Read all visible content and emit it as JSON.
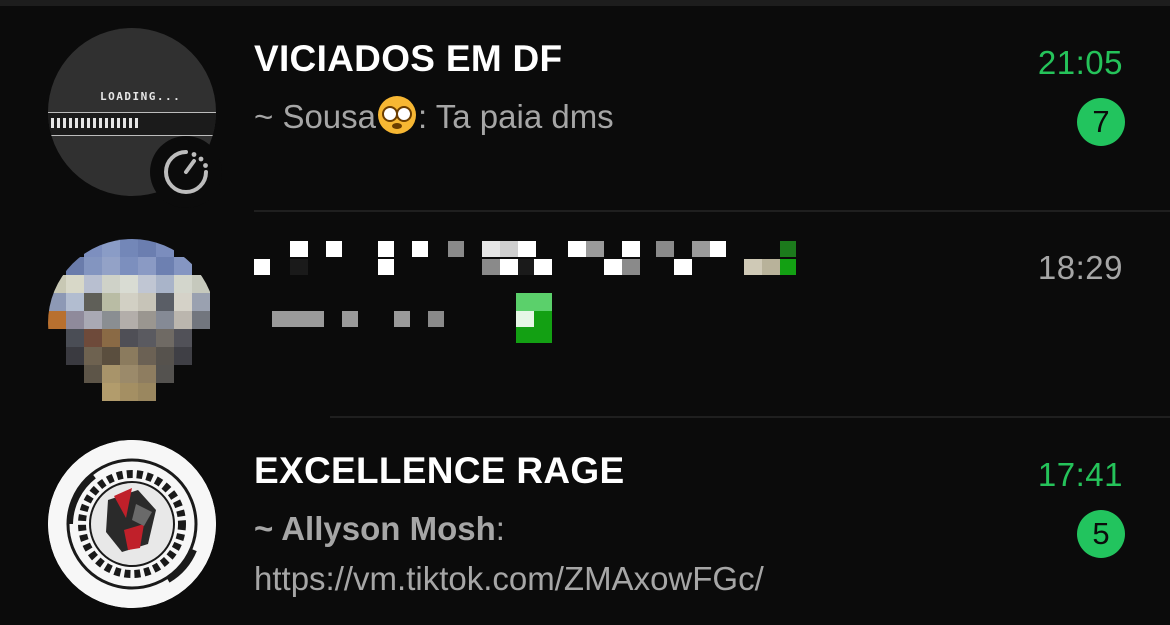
{
  "chats": [
    {
      "name": "VICIADOS EM DF",
      "sender": "~ Sousa",
      "message": ": Ta paia dms",
      "time": "21:05",
      "unread": "7",
      "avatar_text": "LOADING..."
    },
    {
      "name": "",
      "message": "",
      "time": "18:29"
    },
    {
      "name": "EXCELLENCE RAGE",
      "sender": "~ Allyson Mosh",
      "message": ": https://vm.tiktok.com/ZMAxowFGc/",
      "time": "17:41",
      "unread": "5"
    }
  ],
  "colors": {
    "background": "#0b0b0b",
    "accent_green": "#22c45e",
    "muted_text": "#a6a6a6"
  },
  "icons": [
    "timer-icon",
    "dizzy-face-emoji"
  ]
}
